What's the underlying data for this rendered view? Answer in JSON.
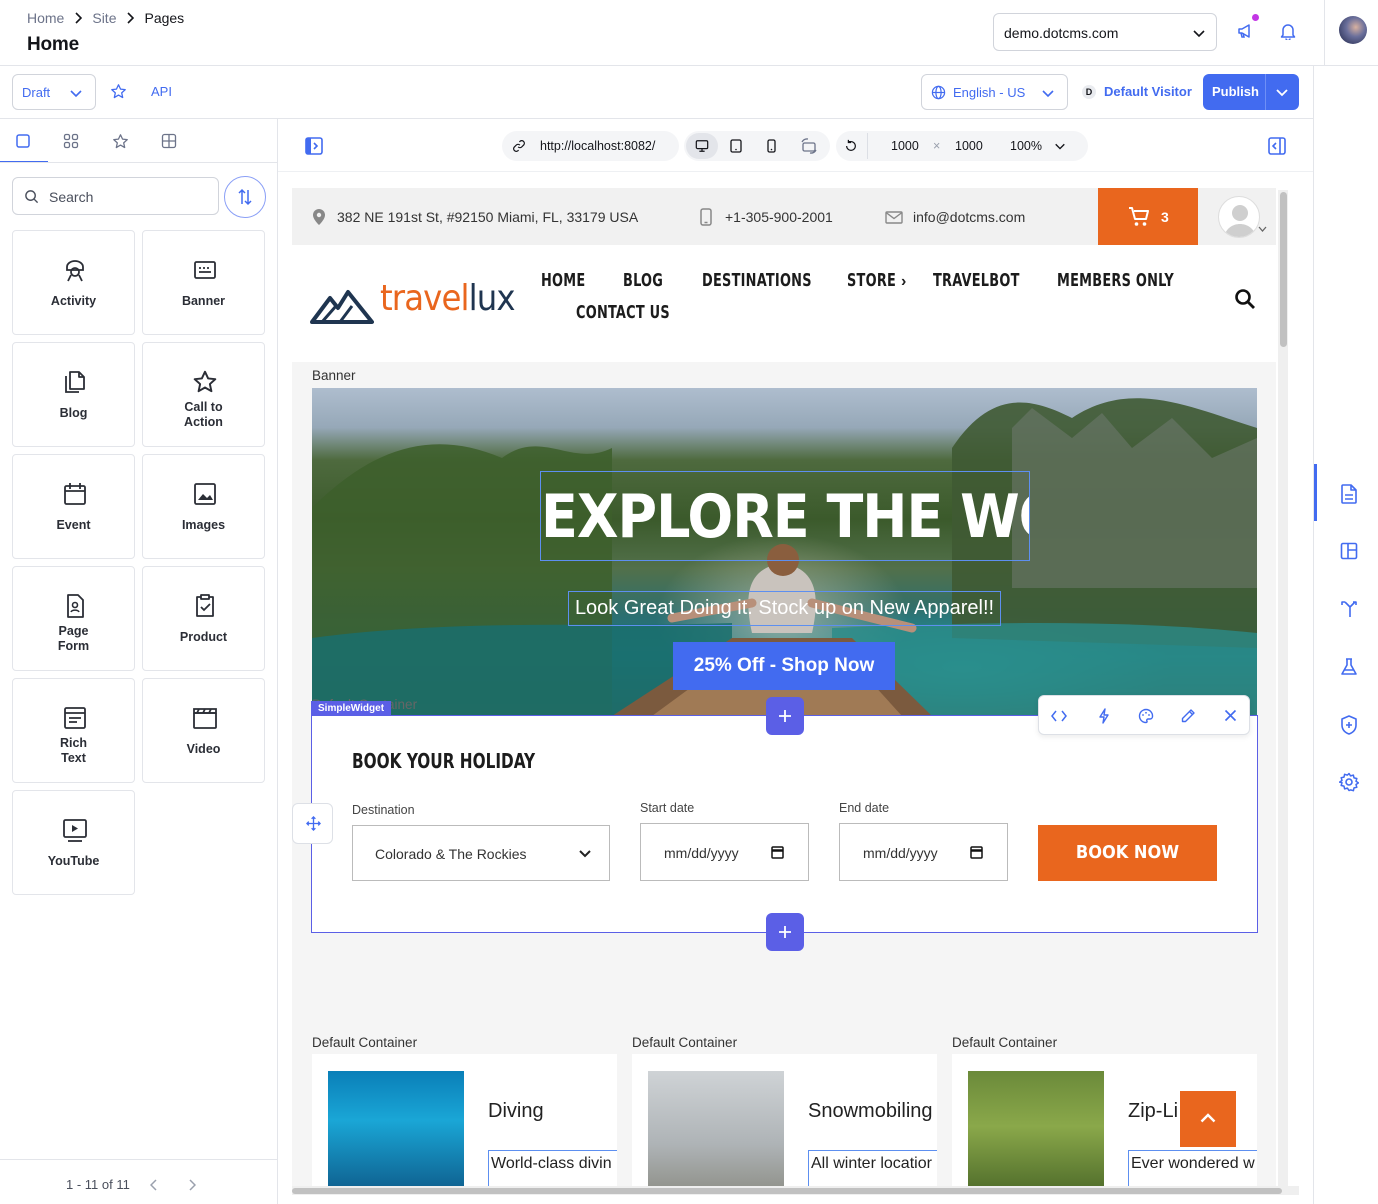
{
  "header": {
    "breadcrumb": [
      "Home",
      "Site",
      "Pages"
    ],
    "title": "Home",
    "site": "demo.dotcms.com"
  },
  "toolbar": {
    "status": "Draft",
    "api_label": "API",
    "language": "English - US",
    "visitor_badge": "D",
    "visitor": "Default Visitor",
    "publish_label": "Publish"
  },
  "sidebar": {
    "search_placeholder": "Search",
    "content_types": [
      {
        "label": "Activity",
        "icon": "activity-icon"
      },
      {
        "label": "Banner",
        "icon": "banner-icon"
      },
      {
        "label": "Blog",
        "icon": "blog-icon"
      },
      {
        "label": "Call to Action",
        "icon": "star-icon"
      },
      {
        "label": "Event",
        "icon": "calendar-icon"
      },
      {
        "label": "Images",
        "icon": "image-icon"
      },
      {
        "label": "Page Form",
        "icon": "form-icon"
      },
      {
        "label": "Product",
        "icon": "clipboard-check-icon"
      },
      {
        "label": "Rich Text",
        "icon": "rich-text-icon"
      },
      {
        "label": "Video",
        "icon": "video-icon"
      },
      {
        "label": "YouTube",
        "icon": "youtube-icon"
      }
    ],
    "pager": "1 - 11 of 11"
  },
  "preview_bar": {
    "url": "http://localhost:8082/",
    "width": "1000",
    "times": "×",
    "height": "1000",
    "zoom": "100%"
  },
  "page": {
    "address": "382 NE 191st St, #92150 Miami, FL, 33179 USA",
    "phone": "+1-305-900-2001",
    "email": "info@dotcms.com",
    "cart_count": "3",
    "logo_text_a": "travel",
    "logo_text_b": "lux",
    "nav": [
      "HOME",
      "BLOG",
      "DESTINATIONS",
      "STORE",
      "TRAVELBOT",
      "MEMBERS ONLY",
      "CONTACT US"
    ],
    "nav_store_chevron": "›",
    "banner_label": "Banner",
    "hero_title": "EXPLORE THE WORLD",
    "hero_subtitle": "Look Great Doing it. Stock up on New Apparel!!",
    "hero_button": "25% Off - Shop Now",
    "widget_tag": "SimpleWidget",
    "widget_hidden_label": "Default Container",
    "booking": {
      "title": "BOOK YOUR HOLIDAY",
      "destination_label": "Destination",
      "destination_value": "Colorado & The Rockies",
      "start_label": "Start date",
      "start_placeholder": "mm/dd/yyyy",
      "end_label": "End date",
      "end_placeholder": "mm/dd/yyyy",
      "button": "BOOK NOW"
    },
    "cards": [
      {
        "container": "Default Container",
        "title": "Diving",
        "text": "World-class divin"
      },
      {
        "container": "Default Container",
        "title": "Snowmobiling",
        "text": "All winter locatior"
      },
      {
        "container": "Default Container",
        "title": "Zip-Li",
        "text": "Ever wondered w"
      }
    ]
  },
  "colors": {
    "primary": "#426bf0",
    "widget": "#5b5fe6",
    "brand_orange": "#e9661e",
    "logo_navy": "#1f3550"
  }
}
